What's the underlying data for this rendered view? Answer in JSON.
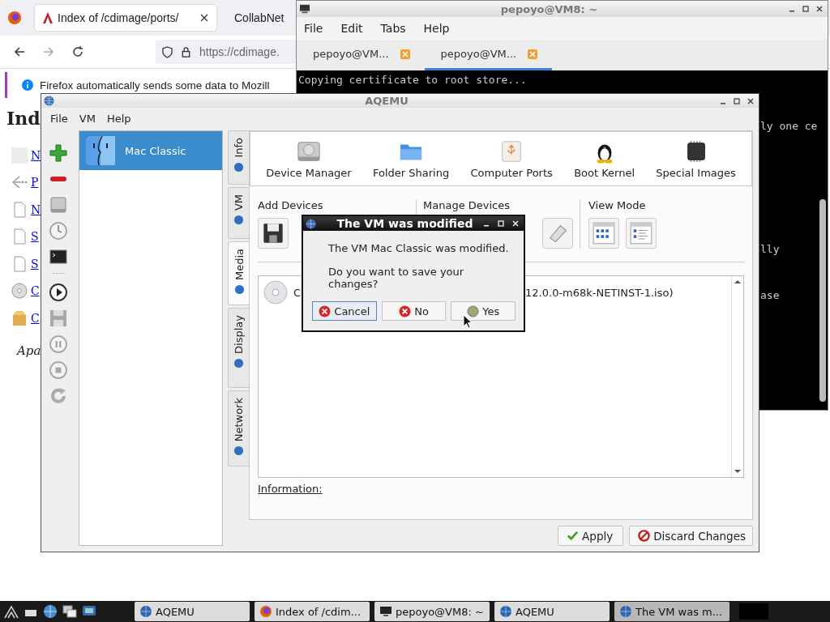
{
  "browser": {
    "tabs": [
      {
        "title": "Index of /cdimage/ports/",
        "selected": true
      },
      {
        "title": "CollabNet",
        "selected": false
      }
    ],
    "url": "https://cdimage.",
    "notification": "Firefox automatically sends some data to Mozill",
    "page": {
      "heading": "Ind",
      "links": [
        "N",
        "P",
        "N",
        "S",
        "S",
        "C",
        "C"
      ],
      "footer": "Apa"
    }
  },
  "terminal": {
    "title": "pepoyo@VM8: ~",
    "menu": [
      "File",
      "Edit",
      "Tabs",
      "Help"
    ],
    "tabs": [
      {
        "label": "pepoyo@VM...",
        "selected": false
      },
      {
        "label": "pepoyo@VM...",
        "selected": true
      }
    ],
    "first_line": "Copying certificate to root store...",
    "fragments": [
      "ly one ce",
      "lly",
      "ase"
    ]
  },
  "aqemu": {
    "title": "AQEMU",
    "menu": [
      "File",
      "VM",
      "Help"
    ],
    "vm_list": [
      {
        "name": "Mac Classic",
        "selected": true
      }
    ],
    "side_tabs": [
      {
        "label": "Info",
        "selected": false
      },
      {
        "label": "VM",
        "selected": false
      },
      {
        "label": "Media",
        "selected": true
      },
      {
        "label": "Display",
        "selected": false
      },
      {
        "label": "Network",
        "selected": false
      }
    ],
    "sections": [
      "Device Manager",
      "Folder Sharing",
      "Computer Ports",
      "Boot Kernel",
      "Special Images"
    ],
    "groups": [
      "Add Devices",
      "Manage Devices",
      "View Mode"
    ],
    "device": {
      "start": "C",
      "end": "12.0.0-m68k-NETINST-1.iso)"
    },
    "information_label": "Information:",
    "buttons": [
      "Apply",
      "Discard Changes"
    ]
  },
  "dialog": {
    "title": "The VM was modified",
    "message": "The VM Mac Classic was modified.",
    "question": "Do you want to save your changes?",
    "buttons": [
      {
        "label": "Cancel",
        "kind": "cancel",
        "focused": true
      },
      {
        "label": "No",
        "kind": "no",
        "focused": false
      },
      {
        "label": "Yes",
        "kind": "yes",
        "focused": false
      }
    ]
  },
  "taskbar": {
    "tasks": [
      {
        "label": "AQEMU",
        "kind": "aqemu",
        "selected": false
      },
      {
        "label": "Index of /cdim...",
        "kind": "browser",
        "selected": false
      },
      {
        "label": "pepoyo@VM8: ~",
        "kind": "terminal",
        "selected": false
      },
      {
        "label": "AQEMU",
        "kind": "aqemu",
        "selected": false
      },
      {
        "label": "The VM was m...",
        "kind": "aqemu",
        "selected": true
      }
    ]
  }
}
